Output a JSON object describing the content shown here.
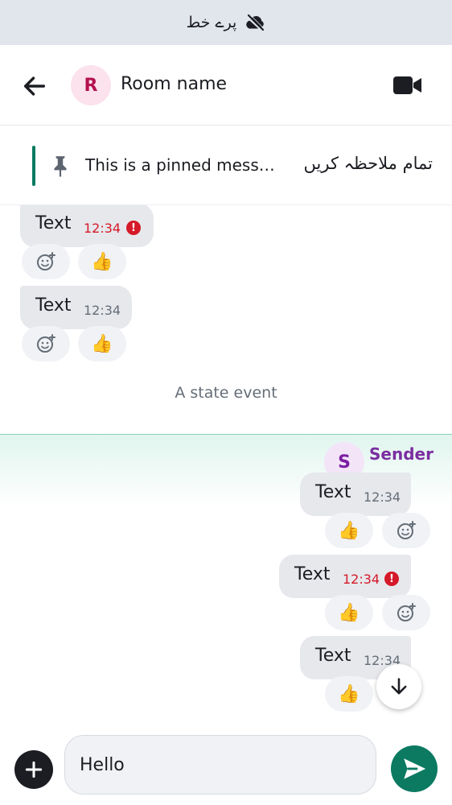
{
  "banner": {
    "text": "پرے خط",
    "icon": "cloud-off-icon"
  },
  "header": {
    "avatar_letter": "R",
    "room_name": "Room name",
    "back_icon": "arrow-left-icon",
    "call_icon": "video-camera-icon"
  },
  "pinned": {
    "text": "This is a pinned mess…",
    "view_all": "تمام ملاحظہ کریں",
    "icon": "pin-icon"
  },
  "messages_incoming": [
    {
      "text": "Text",
      "time": "12:34",
      "error": true,
      "reactions": [
        "add-reaction-icon",
        "👍"
      ]
    },
    {
      "text": "Text",
      "time": "12:34",
      "error": false,
      "reactions": [
        "add-reaction-icon",
        "👍"
      ]
    }
  ],
  "state_event": "A state event",
  "sender": {
    "avatar_letter": "S",
    "name": "Sender"
  },
  "messages_outgoing": [
    {
      "text": "Text",
      "time": "12:34",
      "error": false,
      "reactions": [
        "👍",
        "add-reaction-icon"
      ]
    },
    {
      "text": "Text",
      "time": "12:34",
      "error": true,
      "reactions": [
        "👍",
        "add-reaction-icon"
      ]
    },
    {
      "text": "Text",
      "time": "12:34",
      "error": false,
      "reactions": [
        "👍"
      ]
    }
  ],
  "composer": {
    "value": "Hello",
    "plus_icon": "plus-icon",
    "send_icon": "send-icon"
  },
  "colors": {
    "accent": "#0b7a61",
    "error": "#d51928",
    "sender": "#7b2ea1",
    "room_avatar_bg": "#fbe2ec"
  }
}
